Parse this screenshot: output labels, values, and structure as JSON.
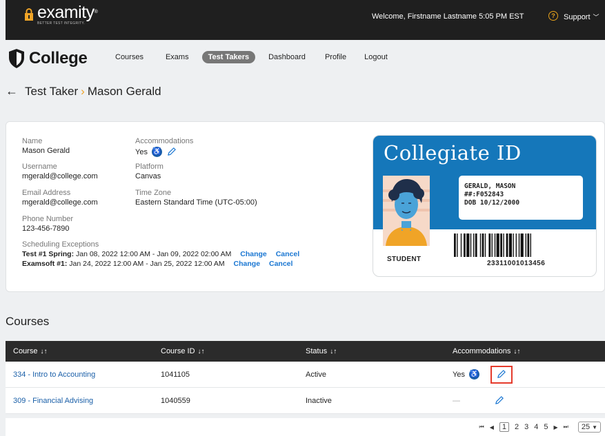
{
  "topbar": {
    "logo_word": "examity",
    "logo_tagline": "BETTER TEST INTEGRITY.",
    "welcome": "Welcome, Firstname Lastname  5:05 PM  EST",
    "support": "Support"
  },
  "nav": {
    "brand": "College",
    "items": [
      "Courses",
      "Exams",
      "Test Takers",
      "Dashboard",
      "Profile",
      "Logout"
    ],
    "active": "Test Takers"
  },
  "breadcrumb": {
    "parent": "Test Taker",
    "current": "Mason Gerald"
  },
  "profile": {
    "name_label": "Name",
    "name": "Mason Gerald",
    "username_label": "Username",
    "username": "mgerald@college.com",
    "email_label": "Email Address",
    "email": "mgerald@college.com",
    "phone_label": "Phone Number",
    "phone": "123-456-7890",
    "acc_label": "Accommodations",
    "acc": "Yes",
    "platform_label": "Platform",
    "platform": "Canvas",
    "tz_label": "Time Zone",
    "tz": "Eastern Standard Time (UTC-05:00)",
    "exceptions_label": "Scheduling Exceptions",
    "exceptions": [
      {
        "name": "Test #1 Spring:",
        "range": "Jan 08, 2022 12:00 AM - Jan 09, 2022 02:00 AM",
        "change": "Change",
        "cancel": "Cancel"
      },
      {
        "name": "Examsoft #1:",
        "range": "Jan 24, 2022 12:00 AM - Jan 25, 2022 12:00 AM",
        "change": "Change",
        "cancel": "Cancel"
      }
    ]
  },
  "id_card": {
    "title": "Collegiate ID",
    "name": "GERALD, MASON",
    "id": "##:F052843",
    "dob": "DOB  10/12/2000",
    "role": "STUDENT",
    "barcode_number": "23311001013456"
  },
  "courses": {
    "title": "Courses",
    "headers": [
      "Course",
      "Course ID",
      "Status",
      "Accommodations"
    ],
    "rows": [
      {
        "course": "334 - Intro to Accounting",
        "id": "1041105",
        "status": "Active",
        "acc": "Yes"
      },
      {
        "course": "309 - Financial Advising",
        "id": "1040559",
        "status": "Inactive",
        "acc": "—"
      }
    ]
  },
  "pager": {
    "pages": [
      "1",
      "2",
      "3",
      "4",
      "5"
    ],
    "current": "1",
    "page_size": "25"
  },
  "colors": {
    "accent": "#1577ba",
    "highlight": "#e53b2c",
    "breadcrumb_sep": "#f0a427"
  }
}
